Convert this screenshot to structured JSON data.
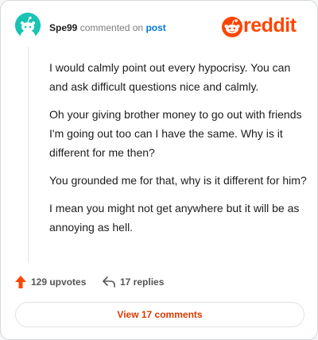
{
  "header": {
    "username": "Spe99",
    "commented_on": "commented on",
    "post_link": "post",
    "logo_text": "reddit"
  },
  "comment": {
    "paragraphs": [
      "I would calmly point out every hypocrisy. You can and ask difficult questions nice and calmly.",
      "Oh your giving brother money to go out with friends I'm going out too can I have the same. Why is it different for me then?",
      "You grounded me for that, why is it different for him?",
      "I mean you might not get anywhere but it will be as annoying as hell."
    ]
  },
  "actions": {
    "upvotes": "129 upvotes",
    "replies": "17 replies"
  },
  "footer": {
    "view_comments": "View 17 comments"
  },
  "colors": {
    "brand": "#ff4500",
    "avatar_bg": "#19c4b3",
    "link": "#0079d3",
    "view_button_text": "#d93a00"
  }
}
